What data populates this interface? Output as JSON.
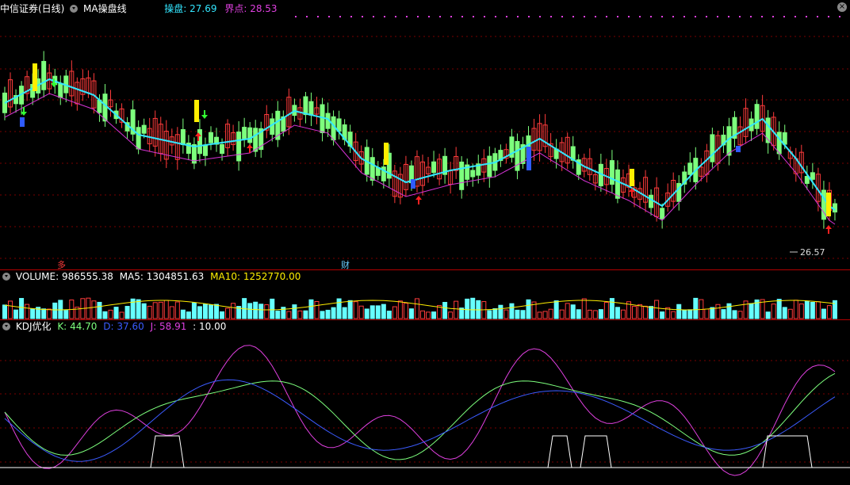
{
  "header": {
    "stock_name": "中信证券(日线)",
    "indicator": "MA操盘线",
    "caopan_label": "操盘:",
    "caopan_value": "27.69",
    "jiedian_label": "界点:",
    "jiedian_value": "28.53"
  },
  "main_chart": {
    "low_label": "26.57",
    "marker_left": "多",
    "marker_mid": "财"
  },
  "volume": {
    "label": "VOLUME:",
    "value": "986555.38",
    "ma5_label": "MA5:",
    "ma5_value": "1304851.63",
    "ma10_label": "MA10:",
    "ma10_value": "1252770.00"
  },
  "kdj": {
    "label": "KDJ优化",
    "k_label": "K:",
    "k_value": "44.70",
    "d_label": "D:",
    "d_value": "37.60",
    "j_label": "J:",
    "j_value": "58.91",
    "extra": ": 10.00"
  },
  "colors": {
    "up": "#ff3b3b",
    "down": "#7dff7d",
    "ma_line": "#33e6ff",
    "ma_slow": "#d633d6",
    "yellow": "#ffee00",
    "blue": "#2f5bff",
    "grid": "#7a0000"
  }
}
